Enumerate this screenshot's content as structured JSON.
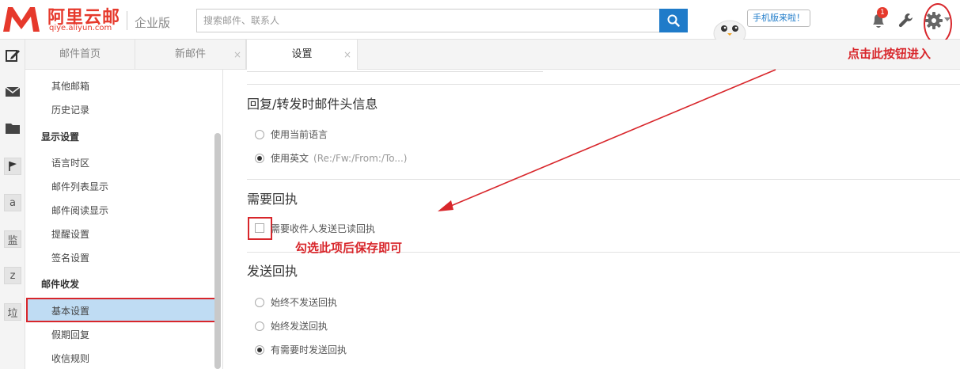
{
  "header": {
    "logo_title": "阿里云邮",
    "logo_subtitle": "qiye.aliyun.com",
    "edition": "企业版",
    "search_placeholder": "搜索邮件、联系人",
    "mobile_bubble": "手机版来啦！",
    "notification_count": "1"
  },
  "rail": {
    "letters": [
      "a",
      "监",
      "z",
      "垃"
    ],
    "icons": [
      "compose-icon",
      "mail-icon",
      "folder-icon",
      "flag-icon"
    ]
  },
  "tabs": [
    {
      "label": "邮件首页"
    },
    {
      "label": "新邮件"
    },
    {
      "label": "设置"
    }
  ],
  "tab_close": "×",
  "sidebar": {
    "items_top": [
      "其他邮箱",
      "历史记录"
    ],
    "group_display": "显示设置",
    "items_display": [
      "语言时区",
      "邮件列表显示",
      "邮件阅读显示",
      "提醒设置",
      "签名设置"
    ],
    "group_mail": "邮件收发",
    "items_mail": [
      "基本设置",
      "假期回复",
      "收信规则"
    ]
  },
  "content": {
    "section_reply": {
      "title": "回复/转发时邮件头信息",
      "opt_current": "使用当前语言",
      "opt_english": "使用英文",
      "opt_english_hint": "(Re:/Fw:/From:/To...)"
    },
    "section_receipt": {
      "title": "需要回执",
      "checkbox_label": "需要收件人发送已读回执"
    },
    "section_send": {
      "title": "发送回执",
      "opt_never": "始终不发送回执",
      "opt_always": "始终发送回执",
      "opt_ask": "有需要时发送回执"
    }
  },
  "annotations": {
    "gear_hint": "点击此按钮进入",
    "check_hint": "勾选此项后保存即可"
  },
  "colors": {
    "brand_red": "#e6392c",
    "accent_blue": "#1f7bc9",
    "annotation_red": "#d8262b",
    "active_nav": "#bfdcf3"
  }
}
